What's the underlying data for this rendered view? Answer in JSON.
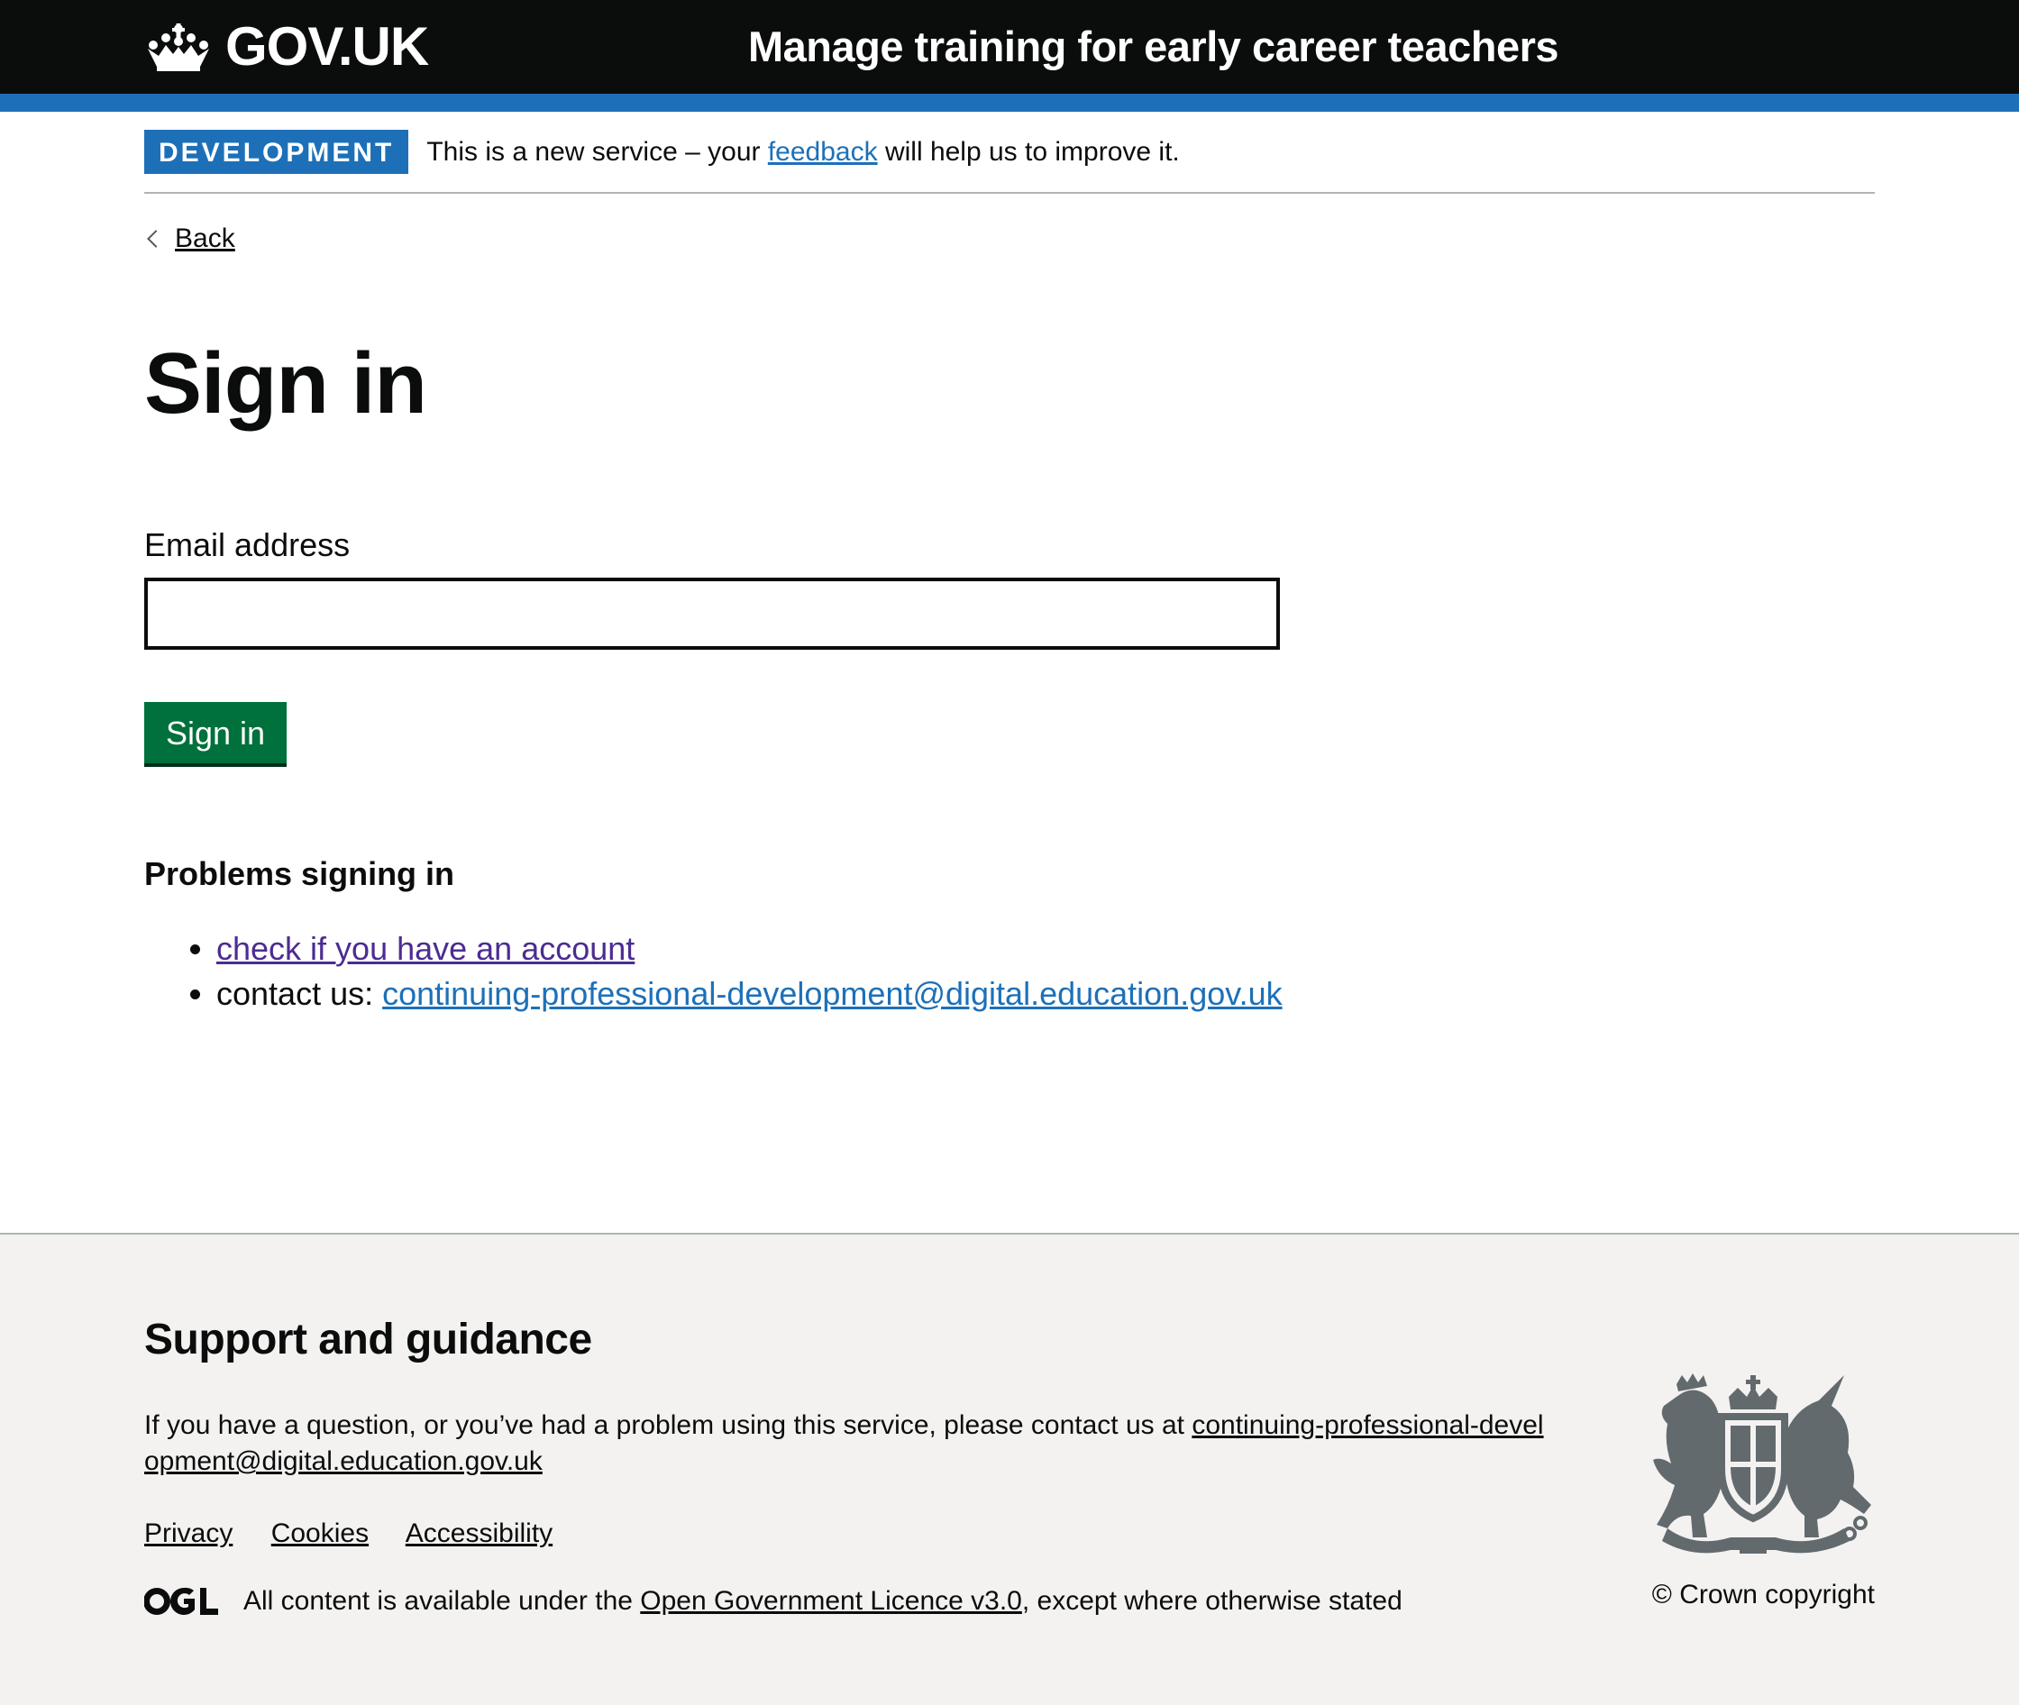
{
  "header": {
    "logo_text": "GOV.UK",
    "service_name": "Manage training for early career teachers"
  },
  "phase_banner": {
    "tag": "DEVELOPMENT",
    "text_before": "This is a new service – your ",
    "link": "feedback",
    "text_after": " will help us to improve it."
  },
  "back_link": "Back",
  "main": {
    "title": "Sign in",
    "email_label": "Email address",
    "email_value": "",
    "submit_label": "Sign in",
    "problems_heading": "Problems signing in",
    "problem_items": {
      "check_account": "check if you have an account",
      "contact_prefix": "contact us: ",
      "contact_email": "continuing-professional-development@digital.education.gov.uk"
    }
  },
  "footer": {
    "heading": "Support and guidance",
    "text_before": "If you have a question, or you’ve had a problem using this service, please contact us at ",
    "email": "continuing-professional-development@digital.education.gov.uk",
    "links": {
      "privacy": "Privacy",
      "cookies": "Cookies",
      "accessibility": "Accessibility"
    },
    "licence_before": "All content is available under the ",
    "licence_link": "Open Government Licence v3.0",
    "licence_after": ", except where otherwise stated",
    "copyright": "© Crown copyright"
  },
  "colors": {
    "brand_blue": "#1d70b8",
    "header_black": "#0b0c0c",
    "button_green": "#00703c",
    "footer_grey": "#f3f2f1",
    "visited_purple": "#4c2c92"
  }
}
